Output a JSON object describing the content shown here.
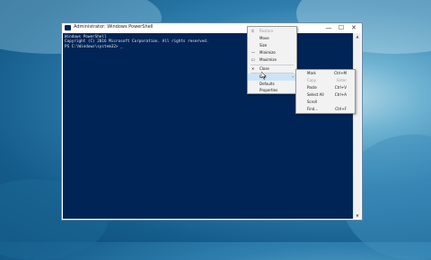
{
  "window": {
    "title": "Administrator: Windows PowerShell",
    "buttons": {
      "minimize": "—",
      "maximize": "☐",
      "close": "✕"
    }
  },
  "console": {
    "lines": [
      "Windows PowerShell",
      "Copyright (C) 2016 Microsoft Corporation. All rights reserved.",
      "",
      "PS C:\\Windows\\system32> _"
    ]
  },
  "system_menu": {
    "items": [
      {
        "label": "Restore",
        "enabled": false,
        "mark": "⧉"
      },
      {
        "label": "Move",
        "enabled": true,
        "mark": ""
      },
      {
        "label": "Size",
        "enabled": true,
        "mark": ""
      },
      {
        "label": "Minimize",
        "enabled": true,
        "mark": "—"
      },
      {
        "label": "Maximize",
        "enabled": true,
        "mark": "☐"
      },
      {
        "label": "Close",
        "enabled": true,
        "mark": "✕"
      },
      {
        "label": "Edit",
        "enabled": true,
        "mark": "",
        "submenu": true
      },
      {
        "label": "Defaults",
        "enabled": true,
        "mark": ""
      },
      {
        "label": "Properties",
        "enabled": true,
        "mark": ""
      }
    ]
  },
  "edit_menu": {
    "items": [
      {
        "label": "Mark",
        "shortcut": "Ctrl+M",
        "enabled": true
      },
      {
        "label": "Copy",
        "shortcut": "Enter",
        "enabled": false
      },
      {
        "label": "Paste",
        "shortcut": "Ctrl+V",
        "enabled": true
      },
      {
        "label": "Select All",
        "shortcut": "Ctrl+A",
        "enabled": true
      },
      {
        "label": "Scroll",
        "shortcut": "",
        "enabled": true
      },
      {
        "label": "Find...",
        "shortcut": "Ctrl+F",
        "enabled": true
      }
    ]
  },
  "colors": {
    "console_bg": "#012456",
    "menu_bg": "#f2f2f2",
    "highlight": "#cde4f7"
  }
}
